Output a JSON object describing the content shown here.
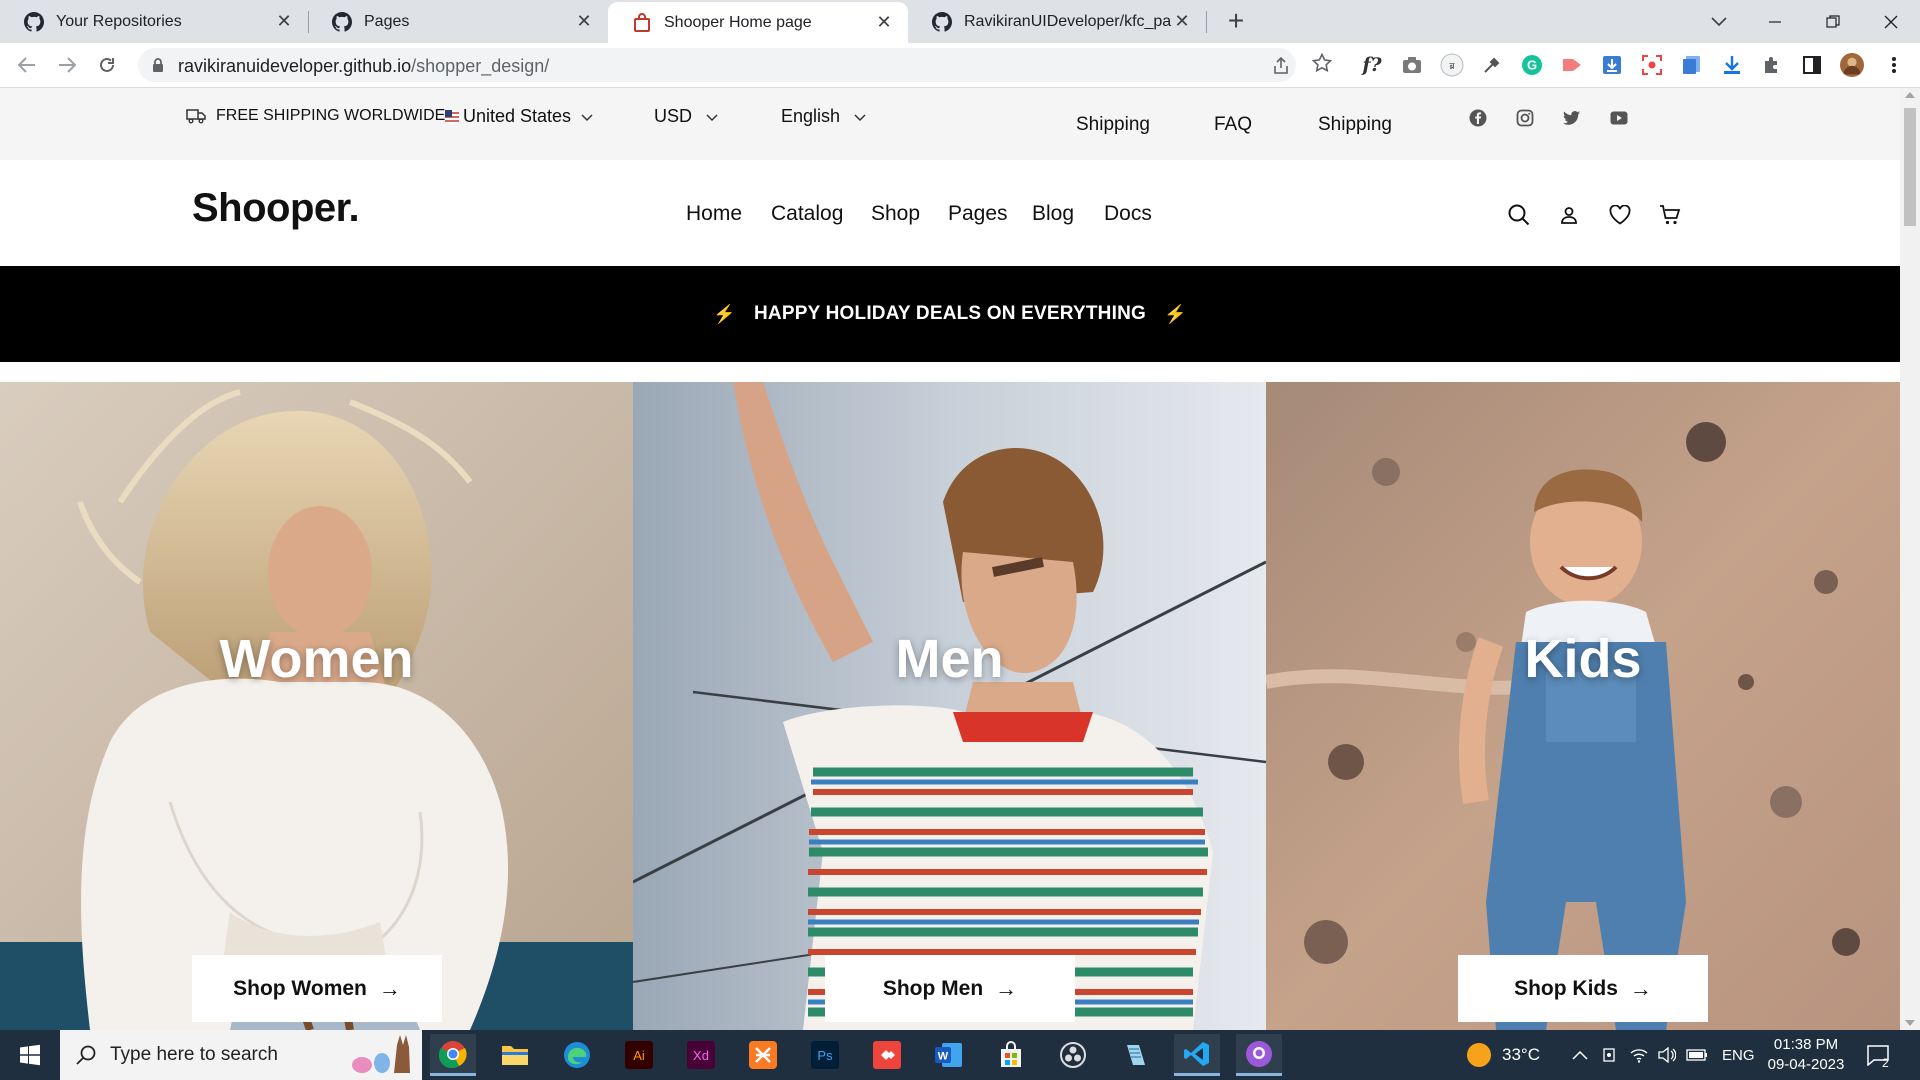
{
  "browser": {
    "tabs": [
      {
        "title": "Your Repositories",
        "icon": "github-icon",
        "active": false
      },
      {
        "title": "Pages",
        "icon": "github-icon",
        "active": false
      },
      {
        "title": "Shooper Home page",
        "icon": "shopping-bag-icon",
        "active": true
      },
      {
        "title": "RavikiranUIDeveloper/kfc_page_c",
        "icon": "github-icon",
        "active": false
      }
    ],
    "url_host": "ravikiranuideveloper.github.io",
    "url_path": "/shopper_design/"
  },
  "topbar": {
    "shipping_text": "FREE SHIPPING WORLDWIDE",
    "country": "United States",
    "currency": "USD",
    "language": "English",
    "links": [
      "Shipping",
      "FAQ",
      "Shipping"
    ],
    "social": [
      "facebook-icon",
      "instagram-icon",
      "twitter-icon",
      "youtube-icon"
    ]
  },
  "header": {
    "logo": "Shooper.",
    "nav": [
      "Home",
      "Catalog",
      "Shop",
      "Pages",
      "Blog",
      "Docs"
    ],
    "icons": [
      "search-icon",
      "user-icon",
      "heart-icon",
      "cart-icon"
    ]
  },
  "promo": {
    "text": "HAPPY HOLIDAY DEALS ON EVERYTHING",
    "bolt": "⚡"
  },
  "categories": [
    {
      "title": "Women",
      "button": "Shop Women"
    },
    {
      "title": "Men",
      "button": "Shop Men"
    },
    {
      "title": "Kids",
      "button": "Shop Kids"
    }
  ],
  "taskbar": {
    "search_placeholder": "Type here to search",
    "weather": "33°C",
    "language": "ENG",
    "time": "01:38 PM",
    "date": "09-04-2023",
    "notifications": "2"
  },
  "colors": {
    "promo_bg": "#000000",
    "bolt": "#f5c518",
    "topbar_bg": "#f5f5f5",
    "taskbar_bg": "#1f2f3f"
  }
}
